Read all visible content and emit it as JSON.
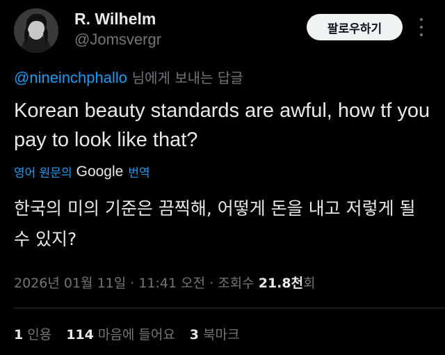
{
  "author": {
    "display_name": "R. Wilhelm",
    "handle": "@Jomsvergr"
  },
  "follow_button": {
    "label": "팔로우하기"
  },
  "reply_to": {
    "mention": "@nineinchphallo",
    "suffix": "님에게 보내는 답글"
  },
  "tweet": {
    "text": "Korean beauty standards are awful, how tf you pay to look like that?"
  },
  "translation": {
    "prefix": "영어 원문의",
    "provider": "Google",
    "suffix": "번역",
    "text": "한국의 미의 기준은 끔찍해, 어떻게 돈을 내고 저렇게 될 수 있지?"
  },
  "meta": {
    "timestamp": "2026년 01월 11일 · 11:41 오전 · 조회수",
    "views_count": "21.8천",
    "views_suffix": "회"
  },
  "stats": {
    "quotes_count": "1",
    "quotes_label": "인용",
    "likes_count": "114",
    "likes_label": "마음에 들어요",
    "bookmarks_count": "3",
    "bookmarks_label": "북마크"
  },
  "colors": {
    "background": "#000000",
    "text_primary": "#e7e9ea",
    "text_secondary": "#71767b",
    "link": "#1d9bf0",
    "button_bg": "#eff3f4",
    "divider": "#2f3336"
  },
  "icons": {
    "more": "more-horizontal-icon",
    "avatar": "user-avatar"
  }
}
